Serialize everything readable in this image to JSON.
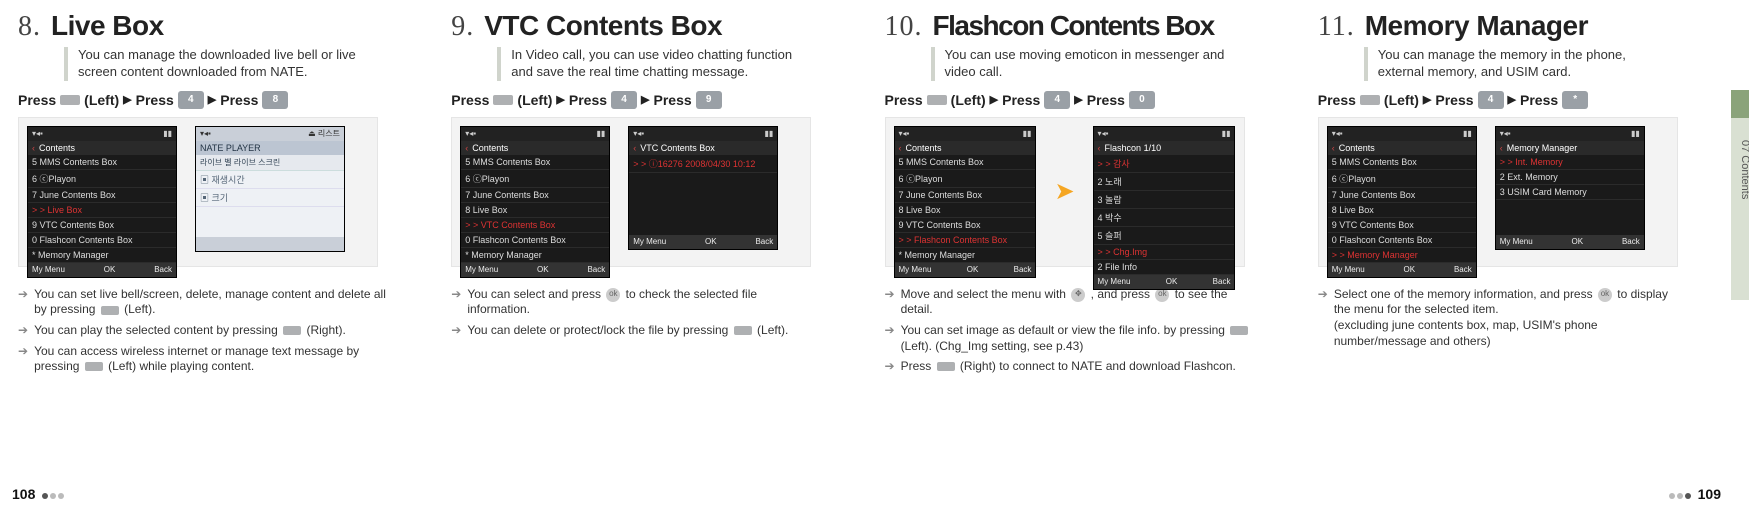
{
  "side_tab": "07  Contents",
  "page_left": "108",
  "page_right": "109",
  "common": {
    "press": "Press",
    "left": "(Left)",
    "right": "(Right)",
    "press_word": "Press",
    "sep": "▶"
  },
  "phone_softkeys": {
    "left": "My Menu",
    "mid": "OK",
    "right": "Back"
  },
  "contents_title": "Contents",
  "sections": [
    {
      "num": "8.",
      "title": "Live Box",
      "desc": "You can manage the downloaded live bell or live screen content downloaded from NATE.",
      "keys": [
        "4",
        "8"
      ],
      "list_a": [
        "5  MMS Contents Box",
        "6  ⓒPlayon",
        "7  June Contents Box",
        "> Live Box",
        "9  VTC Contents Box",
        "0  Flashcon Contents Box",
        "*  Memory Manager"
      ],
      "sel_a": 3,
      "second_title": "NATE PLAYER",
      "second_sub": "라이브 벨       라이브 스크린",
      "second_body": [
        "",
        "",
        "",
        "▣ 재생시간",
        "▣ 크기"
      ],
      "notes": [
        "You can set live bell/screen, delete, manage content and delete all by pressing [SOFT] (Left).",
        "You can play the selected content by pressing [SOFT] (Right).",
        "You can access wireless internet or manage text message by pressing [SOFT] (Left) while playing content."
      ]
    },
    {
      "num": "9.",
      "title": "VTC Contents Box",
      "desc": "In Video call, you can use video chatting function and save the real time chatting message.",
      "keys": [
        "4",
        "9"
      ],
      "list_a": [
        "5  MMS Contents Box",
        "6  ⓒPlayon",
        "7  June Contents Box",
        "8  Live Box",
        "> VTC Contents Box",
        "0  Flashcon Contents Box",
        "*  Memory Manager"
      ],
      "sel_a": 4,
      "second_title": "VTC Contents Box",
      "second_row": "> ⓘ16276  2008/04/30 10:12",
      "notes": [
        "You can select and press [OK] to check the selected file information.",
        "You can delete or protect/lock the file by pressing [SOFT] (Left)."
      ]
    },
    {
      "num": "10.",
      "title": "Flashcon Contents Box",
      "desc": "You can use moving emoticon in messenger and video call.",
      "keys": [
        "4",
        "0"
      ],
      "list_a": [
        "5  MMS Contents Box",
        "6  ⓒPlayon",
        "7  June Contents Box",
        "8  Live Box",
        "9  VTC Contents Box",
        "> Flashcon Contents Box",
        "*  Memory Manager"
      ],
      "sel_a": 5,
      "second_title": "Flashcon                    1/10",
      "second_list": [
        "> 감사",
        "2 노래",
        "3 놀람",
        "4 박수",
        "5 슬퍼",
        "",
        "> Chg.Img",
        "2 File Info"
      ],
      "notes": [
        "Move and select the menu with [OK] , and press [OK] to see the detail.",
        "You can set image as default or view the file info. by pressing [SOFT] (Left). (Chg_Img setting, see p.43)",
        "Press [SOFT] (Right) to connect to NATE and download Flashcon."
      ]
    },
    {
      "num": "11.",
      "title": "Memory Manager",
      "desc": "You can manage the memory in the phone, external memory, and USIM card.",
      "keys": [
        "4",
        "*"
      ],
      "list_a": [
        "5  MMS Contents Box",
        "6  ⓒPlayon",
        "7  June Contents Box",
        "8  Live Box",
        "9  VTC Contents Box",
        "0  Flashcon Contents Box",
        "> Memory Manager"
      ],
      "sel_a": 6,
      "second_title": "Memory Manager",
      "second_list": [
        "> Int. Memory",
        "2 Ext. Memory",
        "3 USIM Card Memory"
      ],
      "notes": [
        "Select one of the memory information, and press [OK] to display the menu for the selected item.\n(excluding june contents box, map, USIM's phone number/message and others)"
      ]
    }
  ]
}
